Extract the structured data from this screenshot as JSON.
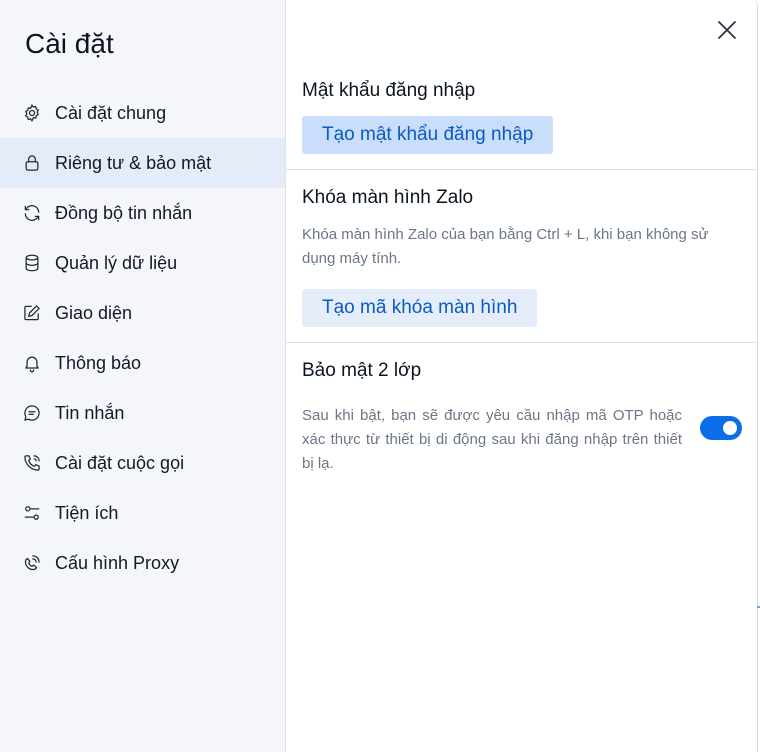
{
  "sidebar": {
    "title": "Cài đặt",
    "items": [
      {
        "label": "Cài đặt chung",
        "icon": "gear-icon"
      },
      {
        "label": "Riêng tư & bảo mật",
        "icon": "lock-icon",
        "active": true
      },
      {
        "label": "Đồng bộ tin nhắn",
        "icon": "sync-icon"
      },
      {
        "label": "Quản lý dữ liệu",
        "icon": "database-icon"
      },
      {
        "label": "Giao diện",
        "icon": "edit-icon"
      },
      {
        "label": "Thông báo",
        "icon": "bell-icon"
      },
      {
        "label": "Tin nhắn",
        "icon": "chat-icon"
      },
      {
        "label": "Cài đặt cuộc gọi",
        "icon": "phone-icon"
      },
      {
        "label": "Tiện ích",
        "icon": "sliders-icon"
      },
      {
        "label": "Cấu hình Proxy",
        "icon": "proxy-icon"
      }
    ]
  },
  "content": {
    "password": {
      "title": "Mật khẩu đăng nhập",
      "button": "Tạo mật khẩu đăng nhập"
    },
    "lock_screen": {
      "title": "Khóa màn hình Zalo",
      "description": "Khóa màn hình Zalo của bạn bằng Ctrl + L, khi bạn không sử dụng máy tính.",
      "button": "Tạo mã khóa màn hình"
    },
    "two_factor": {
      "title": "Bảo mật 2 lớp",
      "description": "Sau khi bật, bạn sẽ được yêu cầu nhập mã OTP hoặc xác thực từ thiết bị di động sau khi đăng nhập trên thiết bị lạ.",
      "enabled": true
    }
  },
  "colors": {
    "accent": "#0b6ee8",
    "button_text": "#0b5bc2",
    "active_nav_bg": "#e3ecf8"
  }
}
